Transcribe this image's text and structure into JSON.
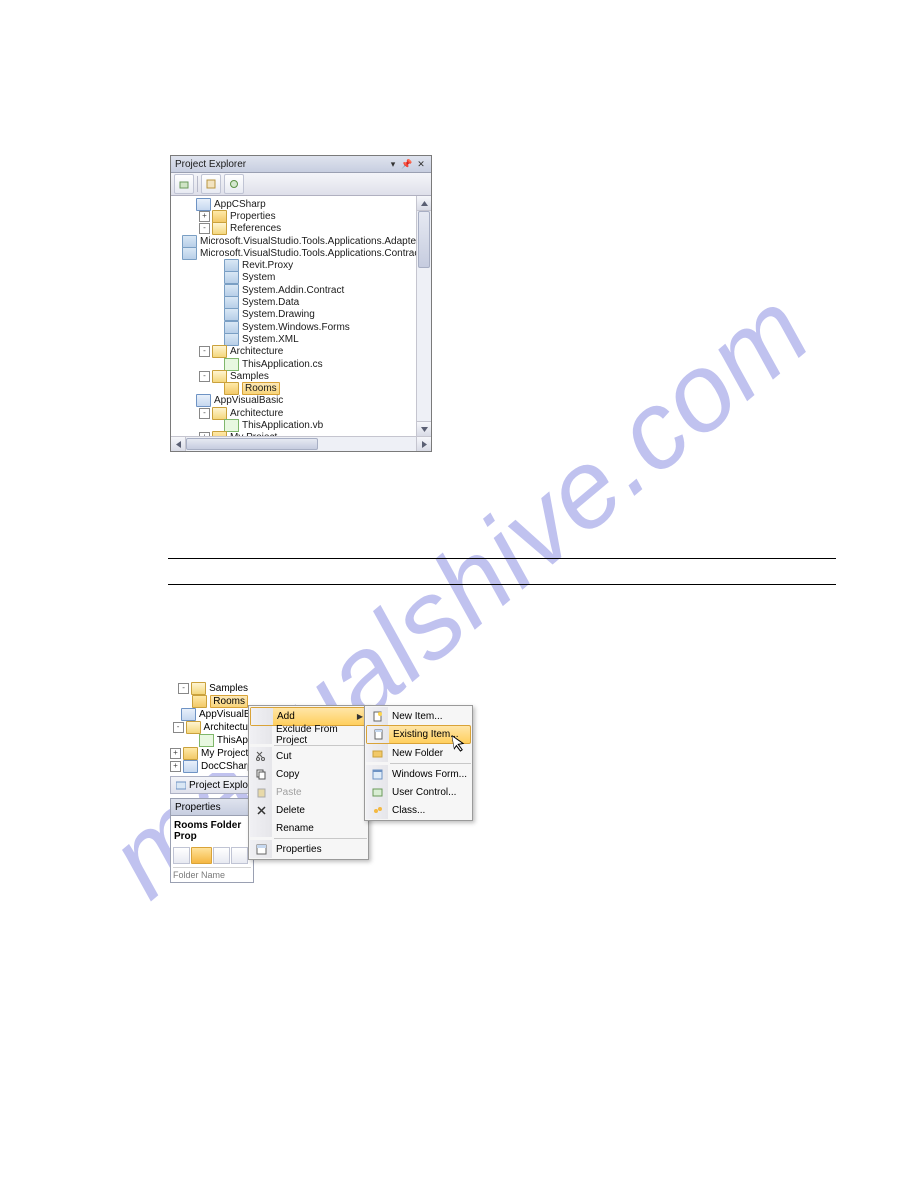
{
  "watermark": "manualshive.com",
  "panel1": {
    "title": "Project Explorer",
    "tree": [
      {
        "depth": 0,
        "exp": "",
        "icon": "proj",
        "label": "AppCSharp"
      },
      {
        "depth": 1,
        "exp": "+",
        "icon": "folder-closed",
        "label": "Properties"
      },
      {
        "depth": 1,
        "exp": "-",
        "icon": "folder-open",
        "label": "References"
      },
      {
        "depth": 2,
        "exp": "",
        "icon": "ref",
        "label": "Microsoft.VisualStudio.Tools.Applications.Adapter"
      },
      {
        "depth": 2,
        "exp": "",
        "icon": "ref",
        "label": "Microsoft.VisualStudio.Tools.Applications.Contract"
      },
      {
        "depth": 2,
        "exp": "",
        "icon": "ref",
        "label": "Revit.Proxy"
      },
      {
        "depth": 2,
        "exp": "",
        "icon": "ref",
        "label": "System"
      },
      {
        "depth": 2,
        "exp": "",
        "icon": "ref",
        "label": "System.Addin.Contract"
      },
      {
        "depth": 2,
        "exp": "",
        "icon": "ref",
        "label": "System.Data"
      },
      {
        "depth": 2,
        "exp": "",
        "icon": "ref",
        "label": "System.Drawing"
      },
      {
        "depth": 2,
        "exp": "",
        "icon": "ref",
        "label": "System.Windows.Forms"
      },
      {
        "depth": 2,
        "exp": "",
        "icon": "ref",
        "label": "System.XML"
      },
      {
        "depth": 1,
        "exp": "-",
        "icon": "folder-open",
        "label": "Architecture"
      },
      {
        "depth": 2,
        "exp": "",
        "icon": "cs",
        "label": "ThisApplication.cs"
      },
      {
        "depth": 1,
        "exp": "-",
        "icon": "folder-open",
        "label": "Samples"
      },
      {
        "depth": 2,
        "exp": "",
        "icon": "folder-closed",
        "label": "Rooms",
        "selected": true
      },
      {
        "depth": 0,
        "exp": "",
        "icon": "proj",
        "label": "AppVisualBasic"
      },
      {
        "depth": 1,
        "exp": "-",
        "icon": "folder-open",
        "label": "Architecture"
      },
      {
        "depth": 2,
        "exp": "",
        "icon": "cs",
        "label": "ThisApplication.vb"
      },
      {
        "depth": 1,
        "exp": "+",
        "icon": "folder-closed",
        "label": "My Project"
      }
    ]
  },
  "panel2": {
    "tree": [
      {
        "depth": 1,
        "exp": "-",
        "icon": "folder-open",
        "label": "Samples"
      },
      {
        "depth": 2,
        "exp": "",
        "icon": "folder-closed",
        "label": "Rooms",
        "selected": true
      },
      {
        "depth": 0,
        "exp": "",
        "icon": "proj",
        "label": "AppVisualBasic"
      },
      {
        "depth": 1,
        "exp": "-",
        "icon": "folder-open",
        "label": "Architectu"
      },
      {
        "depth": 2,
        "exp": "",
        "icon": "cs",
        "label": "ThisAp"
      },
      {
        "depth": 1,
        "exp": "+",
        "icon": "folder-closed",
        "label": "My Project"
      },
      {
        "depth": 0,
        "exp": "+",
        "icon": "proj",
        "label": "DocCSharp(e"
      }
    ],
    "pe_tab": "Project Explorer",
    "props_title": "Properties",
    "props_row": "Rooms Folder Prop",
    "props_cell": "Folder Name"
  },
  "context_menu": {
    "items": [
      {
        "label": "Add",
        "arrow": true,
        "hl": true
      },
      {
        "label": "Exclude From Project"
      },
      {
        "sep": true
      },
      {
        "label": "Cut",
        "icon": "cut"
      },
      {
        "label": "Copy",
        "icon": "copy"
      },
      {
        "label": "Paste",
        "disabled": true,
        "icon": "paste"
      },
      {
        "label": "Delete",
        "icon": "delete"
      },
      {
        "label": "Rename"
      },
      {
        "sep": true
      },
      {
        "label": "Properties",
        "icon": "props"
      }
    ]
  },
  "submenu": {
    "items": [
      {
        "label": "New Item...",
        "icon": "new"
      },
      {
        "label": "Existing Item...",
        "icon": "existing",
        "hl": true
      },
      {
        "label": "New Folder",
        "icon": "folder"
      },
      {
        "sep": true
      },
      {
        "label": "Windows Form...",
        "icon": "form"
      },
      {
        "label": "User Control...",
        "icon": "uc"
      },
      {
        "label": "Class...",
        "icon": "class"
      }
    ]
  }
}
